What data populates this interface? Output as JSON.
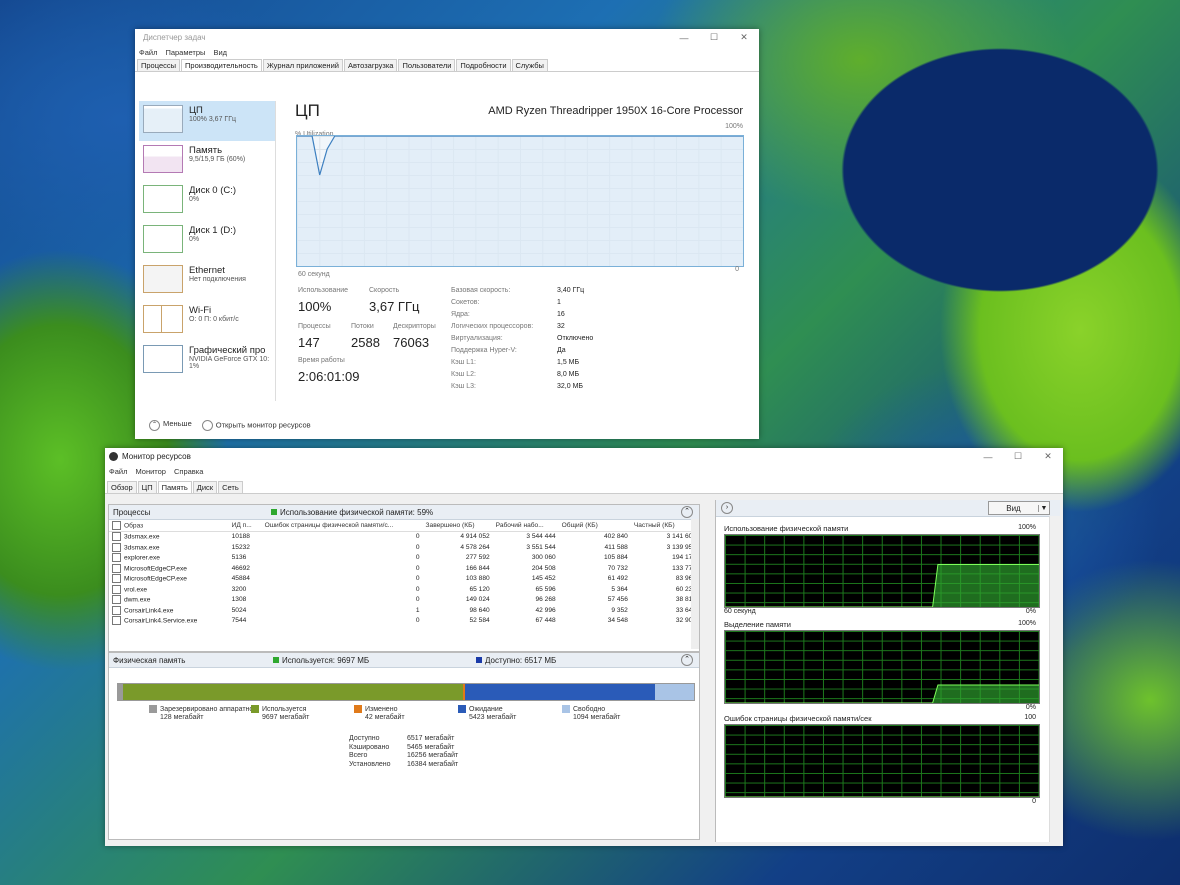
{
  "task_manager": {
    "title": "Диспетчер задач",
    "menu": [
      "Файл",
      "Параметры",
      "Вид"
    ],
    "tabs": [
      "Процессы",
      "Производительность",
      "Журнал приложений",
      "Автозагрузка",
      "Пользователи",
      "Подробности",
      "Службы"
    ],
    "sidebar": [
      {
        "name": "ЦП",
        "detail": "100% 3,67 ГГц"
      },
      {
        "name": "Память",
        "detail": "9,5/15,9 ГБ (60%)"
      },
      {
        "name": "Диск 0 (C:)",
        "detail": "0%"
      },
      {
        "name": "Диск 1 (D:)",
        "detail": "0%"
      },
      {
        "name": "Ethernet",
        "detail": "Нет подключения"
      },
      {
        "name": "Wi-Fi",
        "detail": "О: 0 П: 0 кбит/с"
      },
      {
        "name": "Графический про",
        "detail": "NVIDIA GeForce GTX 10:",
        "detail2": "1%"
      }
    ],
    "cpu": {
      "heading": "ЦП",
      "processor": "AMD Ryzen Threadripper 1950X 16-Core Processor",
      "util_label": "% Utilization",
      "util_max": "100%",
      "time_label": "60 секунд",
      "min_label": "0",
      "graph_values": [
        100,
        100,
        100,
        100,
        100,
        100,
        100,
        100,
        100,
        100,
        100,
        100,
        100,
        100,
        100,
        100,
        100,
        100,
        100,
        100,
        100,
        100,
        100,
        100,
        100,
        100,
        100,
        100,
        100,
        100,
        100,
        100,
        100,
        100,
        100,
        100,
        100,
        100,
        100,
        100,
        100,
        100,
        100,
        100,
        100,
        100,
        100,
        100,
        100,
        100,
        100,
        100,
        100,
        100,
        100,
        90,
        70,
        100,
        100,
        100
      ],
      "stats": {
        "usage_label": "Использование",
        "usage": "100%",
        "speed_label": "Скорость",
        "speed": "3,67 ГГц",
        "proc_label": "Процессы",
        "proc": "147",
        "threads_label": "Потоки",
        "threads": "2588",
        "handles_label": "Дескрипторы",
        "handles": "76063",
        "uptime_label": "Время работы",
        "uptime": "2:06:01:09"
      },
      "specs": [
        {
          "k": "Базовая скорость:",
          "v": "3,40 ГГц"
        },
        {
          "k": "Сокетов:",
          "v": "1"
        },
        {
          "k": "Ядра:",
          "v": "16"
        },
        {
          "k": "Логических процессоров:",
          "v": "32"
        },
        {
          "k": "Виртуализация:",
          "v": "Отключено"
        },
        {
          "k": "Поддержка Hyper-V:",
          "v": "Да"
        },
        {
          "k": "Кэш L1:",
          "v": "1,5 МБ"
        },
        {
          "k": "Кэш L2:",
          "v": "8,0 МБ"
        },
        {
          "k": "Кэш L3:",
          "v": "32,0 МБ"
        }
      ]
    },
    "footer": {
      "less": "Меньше",
      "open_monitor": "Открыть монитор ресурсов"
    }
  },
  "resource_monitor": {
    "title": "Монитор ресурсов",
    "menu": [
      "Файл",
      "Монитор",
      "Справка"
    ],
    "tabs": [
      "Обзор",
      "ЦП",
      "Память",
      "Диск",
      "Сеть"
    ],
    "processes": {
      "heading": "Процессы",
      "summary": "Использование физической памяти: 59%",
      "columns": [
        "Образ",
        "ИД п...",
        "Ошибок страницы физической памяти/с...",
        "Завершено (КБ)",
        "Рабочий набо...",
        "Общий (КБ)",
        "Частный (КБ)"
      ],
      "rows": [
        [
          "3dsmax.exe",
          "10188",
          "0",
          "4 914 052",
          "3 544 444",
          "402 840",
          "3 141 604"
        ],
        [
          "3dsmax.exe",
          "15232",
          "0",
          "4 578 264",
          "3 551 544",
          "411 588",
          "3 139 956"
        ],
        [
          "explorer.exe",
          "5136",
          "0",
          "277 592",
          "300 060",
          "105 884",
          "194 176"
        ],
        [
          "MicrosoftEdgeCP.exe",
          "46692",
          "0",
          "166 844",
          "204 508",
          "70 732",
          "133 776"
        ],
        [
          "MicrosoftEdgeCP.exe",
          "45884",
          "0",
          "103 880",
          "145 452",
          "61 492",
          "83 960"
        ],
        [
          "vrol.exe",
          "3200",
          "0",
          "65 120",
          "65 596",
          "5 364",
          "60 232"
        ],
        [
          "dwm.exe",
          "1308",
          "0",
          "149 024",
          "96 268",
          "57 456",
          "38 812"
        ],
        [
          "CorsairLink4.exe",
          "5024",
          "1",
          "98 640",
          "42 996",
          "9 352",
          "33 644"
        ],
        [
          "CorsairLink4.Service.exe",
          "7544",
          "0",
          "52 584",
          "67 448",
          "34 548",
          "32 900"
        ]
      ]
    },
    "physical_memory": {
      "heading": "Физическая память",
      "used_summary": "Используется: 9697 МБ",
      "avail_summary": "Доступно: 6517 МБ",
      "bar_fractions": {
        "reserved": 0.008,
        "used": 0.592,
        "modified": 0.003,
        "standby": 0.331,
        "free": 0.067
      },
      "legend": [
        {
          "name": "Зарезервировано аппаратно",
          "value": "128 мегабайт",
          "color": "#9a9a9a"
        },
        {
          "name": "Используется",
          "value": "9697 мегабайт",
          "color": "#7a9a2a"
        },
        {
          "name": "Изменено",
          "value": "42 мегабайт",
          "color": "#e07a1a"
        },
        {
          "name": "Ожидание",
          "value": "5423 мегабайт",
          "color": "#2a5bb8"
        },
        {
          "name": "Свободно",
          "value": "1094 мегабайт",
          "color": "#a9c4e6"
        }
      ],
      "totals": [
        {
          "k": "Доступно",
          "v": "6517 мегабайт"
        },
        {
          "k": "Кэшировано",
          "v": "5465 мегабайт"
        },
        {
          "k": "Всего",
          "v": "16256 мегабайт"
        },
        {
          "k": "Установлено",
          "v": "16384 мегабайт"
        }
      ]
    },
    "right_panel": {
      "view_label": "Вид",
      "charts": [
        {
          "title": "Использование физической памяти",
          "max": "100%",
          "time": "60 секунд",
          "min": "0%",
          "values": [
            0,
            0,
            0,
            0,
            0,
            0,
            0,
            0,
            0,
            0,
            0,
            0,
            0,
            0,
            0,
            0,
            0,
            0,
            0,
            0,
            0,
            0,
            0,
            0,
            0,
            0,
            0,
            0,
            0,
            0,
            0,
            0,
            0,
            0,
            0,
            0,
            0,
            0,
            0,
            0,
            59,
            59,
            59,
            59,
            59,
            59,
            59,
            59,
            59,
            59,
            59,
            59,
            59,
            59,
            59,
            59,
            59,
            59,
            59,
            59
          ]
        },
        {
          "title": "Выделение памяти",
          "max": "100%",
          "min": "0%",
          "values": [
            0,
            0,
            0,
            0,
            0,
            0,
            0,
            0,
            0,
            0,
            0,
            0,
            0,
            0,
            0,
            0,
            0,
            0,
            0,
            0,
            0,
            0,
            0,
            0,
            0,
            0,
            0,
            0,
            0,
            0,
            0,
            0,
            0,
            0,
            0,
            0,
            0,
            0,
            0,
            0,
            25,
            25,
            25,
            25,
            25,
            25,
            25,
            25,
            25,
            25,
            25,
            25,
            25,
            25,
            25,
            25,
            25,
            25,
            25,
            25
          ]
        },
        {
          "title": "Ошибок страницы физической памяти/сек",
          "max": "100",
          "min": "0",
          "values": [
            0,
            0,
            0,
            0,
            0,
            0,
            0,
            0,
            0,
            0,
            0,
            0,
            0,
            0,
            0,
            0,
            0,
            0,
            0,
            0,
            0,
            0,
            0,
            0,
            0,
            0,
            0,
            0,
            0,
            0,
            0,
            0,
            0,
            0,
            0,
            0,
            0,
            0,
            0,
            0,
            0,
            0,
            0,
            0,
            0,
            0,
            0,
            0,
            0,
            0,
            0,
            0,
            0,
            0,
            0,
            0,
            0,
            0,
            0,
            0
          ]
        }
      ]
    }
  }
}
